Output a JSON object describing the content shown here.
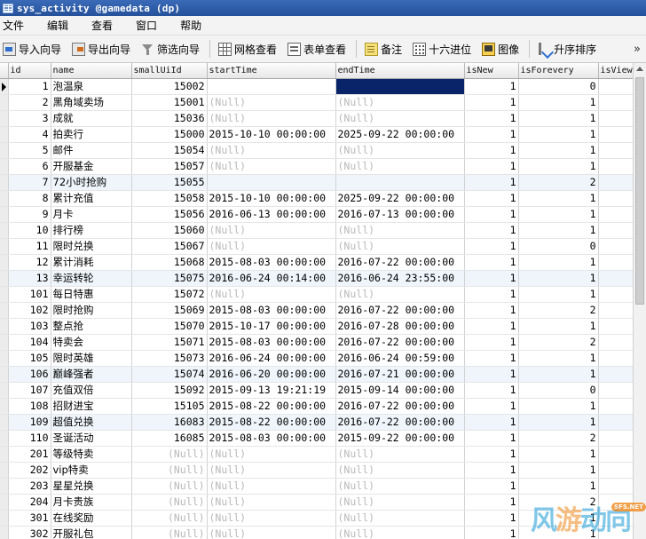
{
  "window": {
    "title": "sys_activity @gamedata (dp)"
  },
  "menu": [
    "文件",
    "编辑",
    "查看",
    "窗口",
    "帮助"
  ],
  "toolbar": [
    {
      "label": "导入向导",
      "icon": "import-wizard-icon"
    },
    {
      "label": "导出向导",
      "icon": "export-wizard-icon"
    },
    {
      "label": "筛选向导",
      "icon": "filter-wizard-icon"
    },
    {
      "label": "网格查看",
      "icon": "grid-view-icon"
    },
    {
      "label": "表单查看",
      "icon": "form-view-icon"
    },
    {
      "label": "备注",
      "icon": "memo-icon"
    },
    {
      "label": "十六进位",
      "icon": "hex-icon"
    },
    {
      "label": "图像",
      "icon": "image-icon"
    },
    {
      "label": "升序排序",
      "icon": "sort-ascending-icon"
    }
  ],
  "toolbar_more": "»",
  "columns": [
    "id",
    "name",
    "smallUiId",
    "startTime",
    "endTime",
    "isNew",
    "isForevery",
    "isView"
  ],
  "rows": [
    {
      "id": "1",
      "name": "泡温泉",
      "smallUiId": "15002",
      "startTime": "",
      "endTime": "",
      "isNew": "1",
      "isForevery": "0",
      "isView": ""
    },
    {
      "id": "2",
      "name": "黑角域卖场",
      "smallUiId": "15001",
      "startTime": "(Null)",
      "endTime": "(Null)",
      "isNew": "1",
      "isForevery": "1",
      "isView": ""
    },
    {
      "id": "3",
      "name": "成就",
      "smallUiId": "15036",
      "startTime": "(Null)",
      "endTime": "(Null)",
      "isNew": "1",
      "isForevery": "1",
      "isView": ""
    },
    {
      "id": "4",
      "name": "拍卖行",
      "smallUiId": "15000",
      "startTime": "2015-10-10 00:00:00",
      "endTime": "2025-09-22 00:00:00",
      "isNew": "1",
      "isForevery": "1",
      "isView": ""
    },
    {
      "id": "5",
      "name": "邮件",
      "smallUiId": "15054",
      "startTime": "(Null)",
      "endTime": "(Null)",
      "isNew": "1",
      "isForevery": "1",
      "isView": ""
    },
    {
      "id": "6",
      "name": "开服基金",
      "smallUiId": "15057",
      "startTime": "(Null)",
      "endTime": "(Null)",
      "isNew": "1",
      "isForevery": "1",
      "isView": ""
    },
    {
      "id": "7",
      "name": "72小时抢购",
      "smallUiId": "15055",
      "startTime": "",
      "endTime": "",
      "isNew": "1",
      "isForevery": "2",
      "isView": ""
    },
    {
      "id": "8",
      "name": "累计充值",
      "smallUiId": "15058",
      "startTime": "2015-10-10 00:00:00",
      "endTime": "2025-09-22 00:00:00",
      "isNew": "1",
      "isForevery": "1",
      "isView": ""
    },
    {
      "id": "9",
      "name": "月卡",
      "smallUiId": "15056",
      "startTime": "2016-06-13 00:00:00",
      "endTime": "2016-07-13 00:00:00",
      "isNew": "1",
      "isForevery": "1",
      "isView": ""
    },
    {
      "id": "10",
      "name": "排行榜",
      "smallUiId": "15060",
      "startTime": "(Null)",
      "endTime": "(Null)",
      "isNew": "1",
      "isForevery": "1",
      "isView": ""
    },
    {
      "id": "11",
      "name": "限时兑换",
      "smallUiId": "15067",
      "startTime": "(Null)",
      "endTime": "(Null)",
      "isNew": "1",
      "isForevery": "0",
      "isView": ""
    },
    {
      "id": "12",
      "name": "累计消耗",
      "smallUiId": "15068",
      "startTime": "2015-08-03 00:00:00",
      "endTime": "2016-07-22 00:00:00",
      "isNew": "1",
      "isForevery": "1",
      "isView": ""
    },
    {
      "id": "13",
      "name": "幸运转轮",
      "smallUiId": "15075",
      "startTime": "2016-06-24 00:14:00",
      "endTime": "2016-06-24 23:55:00",
      "isNew": "1",
      "isForevery": "1",
      "isView": ""
    },
    {
      "id": "101",
      "name": "每日特惠",
      "smallUiId": "15072",
      "startTime": "(Null)",
      "endTime": "(Null)",
      "isNew": "1",
      "isForevery": "1",
      "isView": ""
    },
    {
      "id": "102",
      "name": "限时抢购",
      "smallUiId": "15069",
      "startTime": "2015-08-03 00:00:00",
      "endTime": "2016-07-22 00:00:00",
      "isNew": "1",
      "isForevery": "2",
      "isView": ""
    },
    {
      "id": "103",
      "name": "整点抢",
      "smallUiId": "15070",
      "startTime": "2015-10-17 00:00:00",
      "endTime": "2016-07-28 00:00:00",
      "isNew": "1",
      "isForevery": "1",
      "isView": ""
    },
    {
      "id": "104",
      "name": "特卖会",
      "smallUiId": "15071",
      "startTime": "2015-08-03 00:00:00",
      "endTime": "2016-07-22 00:00:00",
      "isNew": "1",
      "isForevery": "2",
      "isView": ""
    },
    {
      "id": "105",
      "name": "限时英雄",
      "smallUiId": "15073",
      "startTime": "2016-06-24 00:00:00",
      "endTime": "2016-06-24 00:59:00",
      "isNew": "1",
      "isForevery": "1",
      "isView": ""
    },
    {
      "id": "106",
      "name": "巅峰强者",
      "smallUiId": "15074",
      "startTime": "2016-06-20 00:00:00",
      "endTime": "2016-07-21 00:00:00",
      "isNew": "1",
      "isForevery": "1",
      "isView": ""
    },
    {
      "id": "107",
      "name": "充值双倍",
      "smallUiId": "15092",
      "startTime": "2015-09-13 19:21:19",
      "endTime": "2015-09-14 00:00:00",
      "isNew": "1",
      "isForevery": "0",
      "isView": ""
    },
    {
      "id": "108",
      "name": "招财进宝",
      "smallUiId": "15105",
      "startTime": "2015-08-22 00:00:00",
      "endTime": "2016-07-22 00:00:00",
      "isNew": "1",
      "isForevery": "1",
      "isView": ""
    },
    {
      "id": "109",
      "name": "超值兑换",
      "smallUiId": "16083",
      "startTime": "2015-08-22 00:00:00",
      "endTime": "2016-07-22 00:00:00",
      "isNew": "1",
      "isForevery": "1",
      "isView": ""
    },
    {
      "id": "110",
      "name": "圣诞活动",
      "smallUiId": "16085",
      "startTime": "2015-08-03 00:00:00",
      "endTime": "2015-09-22 00:00:00",
      "isNew": "1",
      "isForevery": "2",
      "isView": ""
    },
    {
      "id": "201",
      "name": "等级特卖",
      "smallUiId": "(Null)",
      "startTime": "(Null)",
      "endTime": "(Null)",
      "isNew": "1",
      "isForevery": "1",
      "isView": ""
    },
    {
      "id": "202",
      "name": "vip特卖",
      "smallUiId": "(Null)",
      "startTime": "(Null)",
      "endTime": "(Null)",
      "isNew": "1",
      "isForevery": "1",
      "isView": ""
    },
    {
      "id": "203",
      "name": "星星兑换",
      "smallUiId": "(Null)",
      "startTime": "(Null)",
      "endTime": "(Null)",
      "isNew": "1",
      "isForevery": "1",
      "isView": ""
    },
    {
      "id": "204",
      "name": "月卡贵族",
      "smallUiId": "(Null)",
      "startTime": "(Null)",
      "endTime": "(Null)",
      "isNew": "1",
      "isForevery": "2",
      "isView": ""
    },
    {
      "id": "301",
      "name": "在线奖励",
      "smallUiId": "(Null)",
      "startTime": "(Null)",
      "endTime": "(Null)",
      "isNew": "1",
      "isForevery": "1",
      "isView": ""
    },
    {
      "id": "302",
      "name": "开服礼包",
      "smallUiId": "(Null)",
      "startTime": "(Null)",
      "endTime": "(Null)",
      "isNew": "1",
      "isForevery": "1",
      "isView": ""
    }
  ],
  "highlighted_rows": [
    6,
    12,
    18,
    21
  ],
  "current_row": 0,
  "selected_cell": {
    "row": 0,
    "column": "endTime"
  },
  "watermark": {
    "text_a": "风",
    "text_b": "游",
    "text_c": "动向",
    "badge": "SFS.NET"
  },
  "colors": {
    "titlebar": "#25519a",
    "selection": "#0a246a",
    "null_text": "#b9b9b9",
    "row_highlight": "#eff5fb"
  }
}
